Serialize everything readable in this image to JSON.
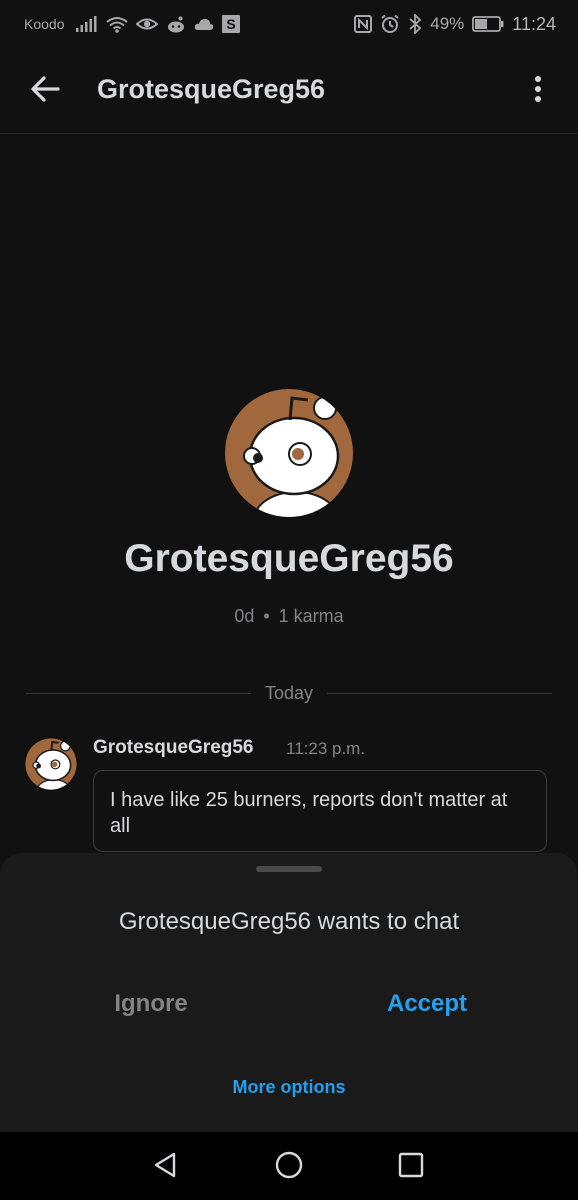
{
  "status_bar": {
    "carrier": "Koodo",
    "battery_percent": "49%",
    "time": "11:24",
    "left_icons": [
      "signal-icon",
      "wifi-icon",
      "eye-icon",
      "reddit-icon",
      "cloud-icon",
      "s-app-icon"
    ],
    "right_icons": [
      "nfc-icon",
      "alarm-icon",
      "bluetooth-icon",
      "battery-icon"
    ]
  },
  "app_bar": {
    "title": "GrotesqueGreg56",
    "back_icon": "arrow-left-icon",
    "menu_icon": "more-vertical-icon"
  },
  "profile": {
    "username": "GrotesqueGreg56",
    "age": "0d",
    "separator": "•",
    "karma": "1 karma",
    "avatar_color": "#a0683c"
  },
  "divider": {
    "label": "Today"
  },
  "message": {
    "author": "GrotesqueGreg56",
    "time": "11:23 p.m.",
    "text": "I have like 25 burners, reports don't matter at all"
  },
  "chat_request": {
    "title": "GrotesqueGreg56 wants to chat",
    "ignore_label": "Ignore",
    "accept_label": "Accept",
    "more_options_label": "More options",
    "accent_color": "#24a0ed"
  },
  "nav_bar": {
    "icons": [
      "back-triangle-icon",
      "home-circle-icon",
      "recents-square-icon"
    ]
  }
}
